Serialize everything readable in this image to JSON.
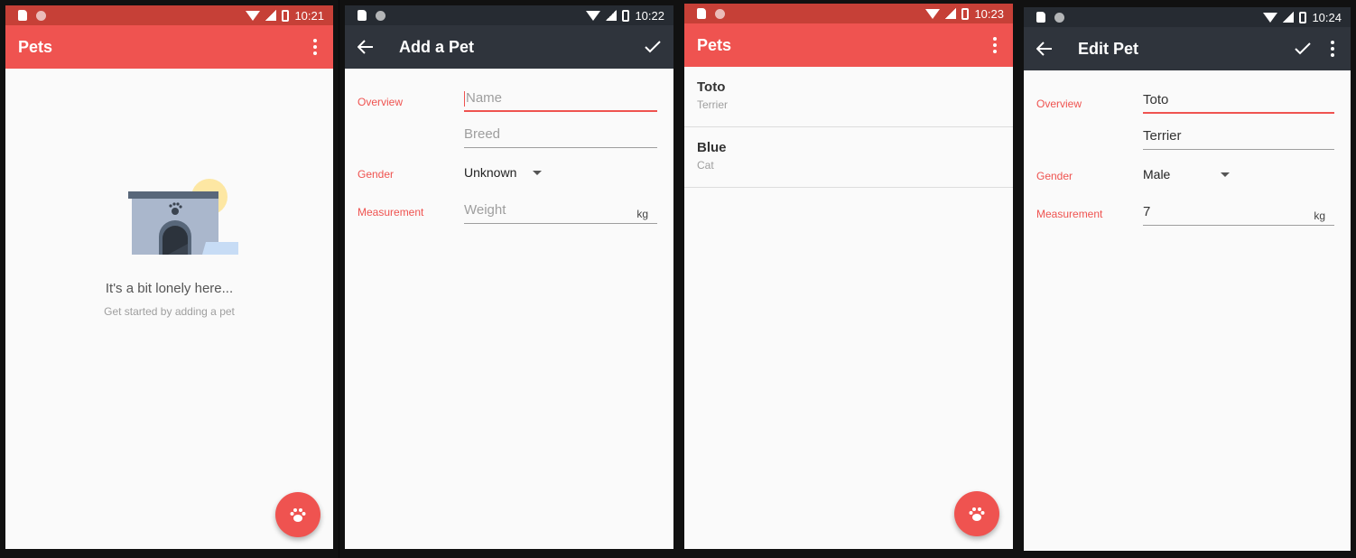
{
  "colors": {
    "accent": "#ef5350",
    "accent_dark": "#c64037",
    "dark_bar": "#2f343c",
    "dark_status": "#262b32"
  },
  "screens": [
    {
      "status": {
        "time": "10:21"
      },
      "appbar": {
        "title": "Pets",
        "menu_icon": "more-vert-icon"
      },
      "empty": {
        "illustration": "dog-house-illustration",
        "title": "It's a bit lonely here...",
        "subtitle": "Get started by adding a pet"
      },
      "fab": {
        "icon": "paw-icon"
      }
    },
    {
      "status": {
        "time": "10:22"
      },
      "appbar": {
        "title": "Add a Pet",
        "back_icon": "arrow-back-icon",
        "save_icon": "check-icon"
      },
      "form": {
        "overview_label": "Overview",
        "name_placeholder": "Name",
        "breed_placeholder": "Breed",
        "gender_label": "Gender",
        "gender_value": "Unknown",
        "measurement_label": "Measurement",
        "weight_placeholder": "Weight",
        "weight_unit": "kg"
      }
    },
    {
      "status": {
        "time": "10:23"
      },
      "appbar": {
        "title": "Pets",
        "menu_icon": "more-vert-icon"
      },
      "list": [
        {
          "name": "Toto",
          "breed": "Terrier"
        },
        {
          "name": "Blue",
          "breed": "Cat"
        }
      ],
      "fab": {
        "icon": "paw-icon"
      }
    },
    {
      "status": {
        "time": "10:24"
      },
      "appbar": {
        "title": "Edit Pet",
        "back_icon": "arrow-back-icon",
        "save_icon": "check-icon",
        "menu_icon": "more-vert-icon"
      },
      "form": {
        "overview_label": "Overview",
        "name_value": "Toto",
        "breed_value": "Terrier",
        "gender_label": "Gender",
        "gender_value": "Male",
        "measurement_label": "Measurement",
        "weight_value": "7",
        "weight_unit": "kg"
      }
    }
  ]
}
